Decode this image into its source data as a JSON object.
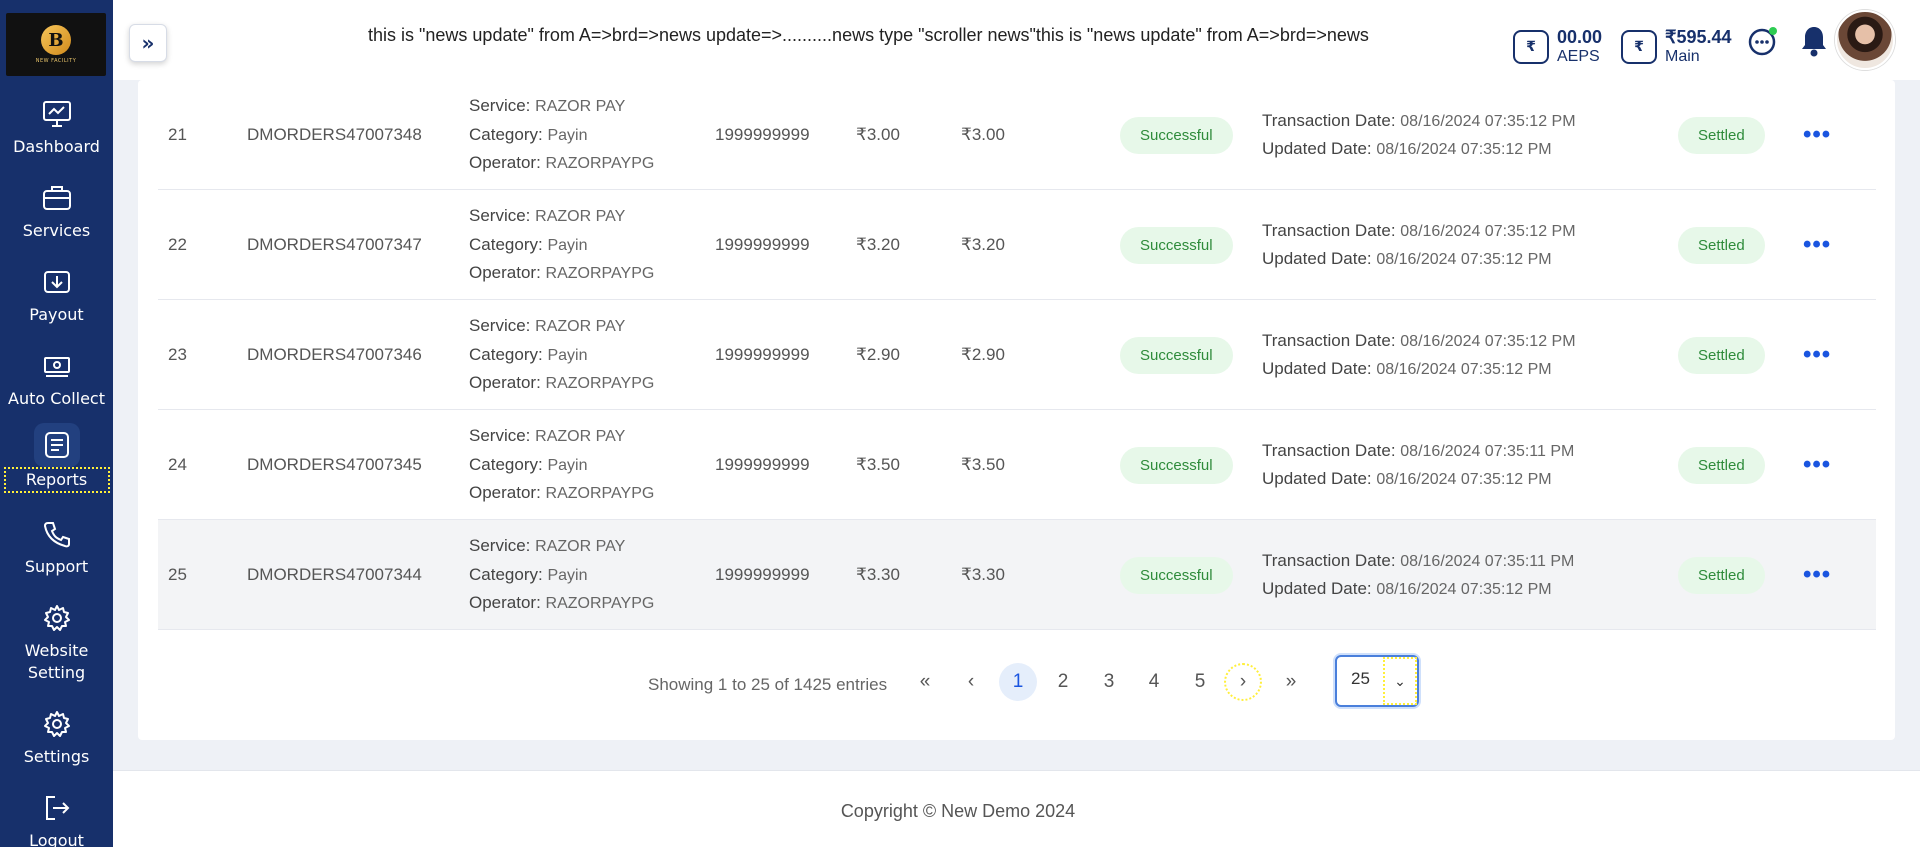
{
  "ticker": "this is \"news update\" from A=>brd=>news update=>..........news type \"scroller news\"this is \"news update\" from A=>brd=>news",
  "logo_text": "NEW FACILITY",
  "logo_letter": "B",
  "sidebar": {
    "items": [
      {
        "label": "Dashboard",
        "icon": "dashboard-icon"
      },
      {
        "label": "Services",
        "icon": "briefcase-icon"
      },
      {
        "label": "Payout",
        "icon": "payout-icon"
      },
      {
        "label": "Auto Collect",
        "icon": "auto-collect-icon"
      },
      {
        "label": "Reports",
        "icon": "reports-icon"
      },
      {
        "label": "Support",
        "icon": "phone-icon"
      },
      {
        "label": "Website Setting",
        "icon": "gear-icon"
      },
      {
        "label": "Settings",
        "icon": "gear-icon"
      },
      {
        "label": "Logout",
        "icon": "logout-icon"
      }
    ]
  },
  "wallets": [
    {
      "amount": "00.00",
      "label": "AEPS",
      "icon_text": "₹"
    },
    {
      "amount": "₹595.44",
      "label": "Main",
      "icon_text": "₹"
    }
  ],
  "table": {
    "rows": [
      {
        "idx": "21",
        "order": "DMORDERS47007348",
        "service": "RAZOR PAY",
        "category": "Payin",
        "operator": "RAZORPAYPG",
        "phone": "1999999999",
        "amount": "₹3.00",
        "amount2": "₹3.00",
        "status": "Successful",
        "txn_date": "08/16/2024 07:35:12 PM",
        "upd_date": "08/16/2024 07:35:12 PM",
        "settle": "Settled"
      },
      {
        "idx": "22",
        "order": "DMORDERS47007347",
        "service": "RAZOR PAY",
        "category": "Payin",
        "operator": "RAZORPAYPG",
        "phone": "1999999999",
        "amount": "₹3.20",
        "amount2": "₹3.20",
        "status": "Successful",
        "txn_date": "08/16/2024 07:35:12 PM",
        "upd_date": "08/16/2024 07:35:12 PM",
        "settle": "Settled"
      },
      {
        "idx": "23",
        "order": "DMORDERS47007346",
        "service": "RAZOR PAY",
        "category": "Payin",
        "operator": "RAZORPAYPG",
        "phone": "1999999999",
        "amount": "₹2.90",
        "amount2": "₹2.90",
        "status": "Successful",
        "txn_date": "08/16/2024 07:35:12 PM",
        "upd_date": "08/16/2024 07:35:12 PM",
        "settle": "Settled"
      },
      {
        "idx": "24",
        "order": "DMORDERS47007345",
        "service": "RAZOR PAY",
        "category": "Payin",
        "operator": "RAZORPAYPG",
        "phone": "1999999999",
        "amount": "₹3.50",
        "amount2": "₹3.50",
        "status": "Successful",
        "txn_date": "08/16/2024 07:35:11 PM",
        "upd_date": "08/16/2024 07:35:12 PM",
        "settle": "Settled"
      },
      {
        "idx": "25",
        "order": "DMORDERS47007344",
        "service": "RAZOR PAY",
        "category": "Payin",
        "operator": "RAZORPAYPG",
        "phone": "1999999999",
        "amount": "₹3.30",
        "amount2": "₹3.30",
        "status": "Successful",
        "txn_date": "08/16/2024 07:35:11 PM",
        "upd_date": "08/16/2024 07:35:12 PM",
        "settle": "Settled"
      }
    ],
    "labels": {
      "service": "Service:",
      "category": "Category:",
      "operator": "Operator:",
      "txn_date": "Transaction Date:",
      "upd_date": "Updated Date:"
    }
  },
  "pagination": {
    "showing": "Showing 1 to 25 of 1425 entries",
    "first": "«",
    "prev": "‹",
    "pages": [
      "1",
      "2",
      "3",
      "4",
      "5"
    ],
    "active_page": "1",
    "next": "›",
    "last": "»",
    "per_page": "25"
  },
  "footer": "Copyright © New Demo 2024"
}
